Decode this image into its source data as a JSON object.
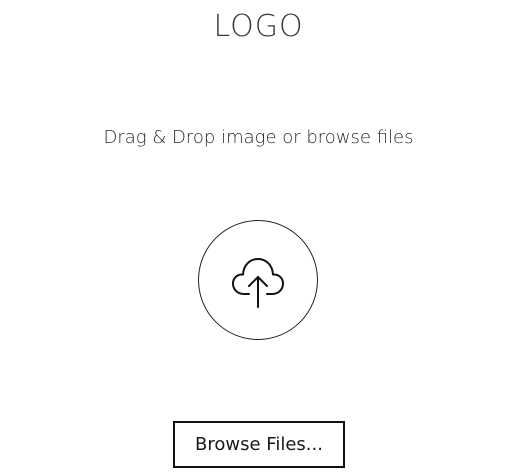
{
  "logo": {
    "text": "LOGO"
  },
  "dropzone": {
    "instruction": "Drag & Drop image or browse files",
    "icon": "cloud-upload-icon"
  },
  "actions": {
    "browse_label": "Browse Files..."
  }
}
